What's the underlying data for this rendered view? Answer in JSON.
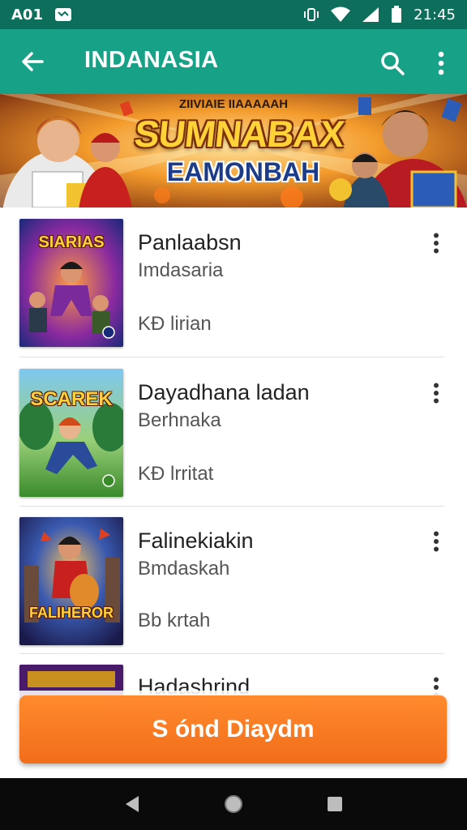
{
  "status_bar": {
    "left_text": "A01",
    "time": "21:45",
    "icons": [
      "message-icon",
      "vibrate-icon",
      "wifi-icon",
      "signal-icon",
      "battery-icon"
    ]
  },
  "app_bar": {
    "title": "INDANASIA",
    "icons": [
      "back-arrow-icon",
      "search-icon",
      "more-vert-icon"
    ],
    "color": "#17a186"
  },
  "banner": {
    "kicker": "ZIIVIAIE IIAAAAAH",
    "headline": "SUMNABAX",
    "subheadline": "EAMONBAH"
  },
  "list": {
    "items": [
      {
        "thumb_title": "SIARIAS",
        "title": "Panlaabsn",
        "subtitle": "Imdasaria",
        "meta": "KĐ lirian"
      },
      {
        "thumb_title": "SCAREK",
        "title": "Dayadhana ladan",
        "subtitle": "Berhnaka",
        "meta": "KĐ lrritat"
      },
      {
        "thumb_title": "FALIHEROR",
        "title": "Falinekiakin",
        "subtitle": "Bmdaskah",
        "meta": "Bb krtah"
      },
      {
        "thumb_title": "",
        "title": "Hadashrind",
        "subtitle": "",
        "meta": ""
      }
    ]
  },
  "cta": {
    "label": "S ónd Diaydm",
    "color": "#f47a22"
  },
  "nav_bar": {
    "icons": [
      "back-triangle-icon",
      "home-circle-icon",
      "recents-square-icon"
    ]
  }
}
